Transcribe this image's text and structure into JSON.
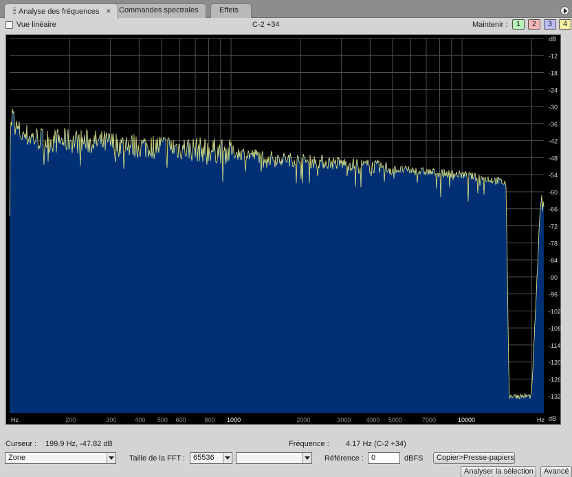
{
  "tabs": [
    {
      "label": "Analyse des fréquences",
      "active": true
    },
    {
      "label": "Commandes spectrales",
      "active": false
    },
    {
      "label": "Effets",
      "active": false
    }
  ],
  "options": {
    "linear_view_label": "Vue linéaire",
    "linear_view_checked": false,
    "pitch_readout": "C-2 +34",
    "hold_label": "Maintenir :",
    "hold_buttons": [
      "1",
      "2",
      "3",
      "4"
    ],
    "hold_colors": [
      "#b8f4b8",
      "#f6b6b6",
      "#bcbcf6",
      "#f6f0a4"
    ]
  },
  "chart_data": {
    "type": "area",
    "x_scale": "log",
    "y_unit_label": "dB",
    "x_unit_label": "Hz",
    "y_ticks": [
      "dB",
      "-12",
      "-18",
      "-24",
      "-30",
      "-36",
      "-42",
      "-48",
      "-54",
      "-60",
      "-66",
      "-72",
      "-78",
      "-84",
      "-90",
      "-96",
      "-102",
      "-108",
      "-114",
      "-120",
      "-126",
      "-132",
      "dB"
    ],
    "x_ticks": [
      "Hz",
      "200",
      "300",
      "400",
      "500",
      "600",
      "800",
      "1000",
      "2000",
      "3000",
      "4000",
      "5000",
      "7000",
      "10000",
      "Hz"
    ],
    "x_bold_ticks": [
      "1000",
      "10000"
    ],
    "ylim": [
      -138,
      -6
    ],
    "series": [
      {
        "fill_color": "#003073",
        "trace_color": "#e6f08c",
        "points": [
          [
            110,
            -42
          ],
          [
            113,
            -33
          ],
          [
            118,
            -38
          ],
          [
            125,
            -40
          ],
          [
            140,
            -41
          ],
          [
            160,
            -42
          ],
          [
            200,
            -42
          ],
          [
            300,
            -43
          ],
          [
            400,
            -44
          ],
          [
            500,
            -44
          ],
          [
            700,
            -45
          ],
          [
            1000,
            -46
          ],
          [
            1500,
            -48
          ],
          [
            2000,
            -49
          ],
          [
            3000,
            -50
          ],
          [
            4000,
            -51
          ],
          [
            5000,
            -52
          ],
          [
            7000,
            -53
          ],
          [
            10000,
            -54
          ],
          [
            14000,
            -56
          ],
          [
            15500,
            -57
          ],
          [
            16000,
            -132
          ],
          [
            20000,
            -132
          ],
          [
            22000,
            -59
          ],
          [
            22500,
            -64
          ]
        ]
      }
    ]
  },
  "readouts": {
    "cursor_label": "Curseur :",
    "cursor_value": "199.9 Hz, -47.82 dB",
    "frequency_label": "Fréquence :",
    "frequency_value": "4.17 Hz (C-2 +34)"
  },
  "controls": {
    "mode_value": "Zone",
    "fft_label": "Taille de la FFT :",
    "fft_value": "65536",
    "window_value": "",
    "reference_label": "Référence :",
    "reference_value": "0",
    "reference_unit": "dBFS",
    "copy_button": "Copier>Presse-papiers",
    "analyze_button": "Analyser la sélection",
    "advanced_button": "Avancé"
  },
  "colors": {
    "plot_background": "#000000",
    "spectrum_fill": "#003073",
    "spectrum_trace": "#e6f08c",
    "grid": "#4e4e4e"
  }
}
